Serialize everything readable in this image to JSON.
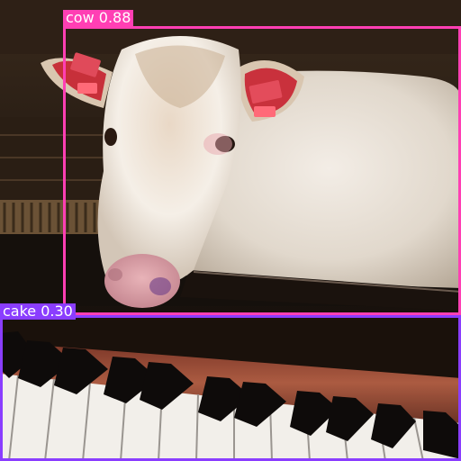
{
  "detections": [
    {
      "label": "cow 0.88",
      "class": "cow",
      "score": 0.88,
      "color": "#ff3fb4"
    },
    {
      "label": "cake 0.30",
      "class": "cake",
      "score": 0.3,
      "color": "#8a3dff"
    }
  ],
  "colors": {
    "cow_box": "#ff3fb4",
    "cake_box": "#8a3dff"
  }
}
